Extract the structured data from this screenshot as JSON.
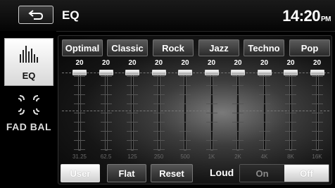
{
  "header": {
    "title": "EQ",
    "time": "14:20",
    "ampm": "PM"
  },
  "sidebar": {
    "eq_label": "EQ",
    "fad_bal_label": "FAD BAL"
  },
  "presets": [
    "Optimal",
    "Classic",
    "Rock",
    "Jazz",
    "Techno",
    "Pop"
  ],
  "bands": [
    {
      "freq": "31.25",
      "value": "20"
    },
    {
      "freq": "62.5",
      "value": "20"
    },
    {
      "freq": "125",
      "value": "20"
    },
    {
      "freq": "250",
      "value": "20"
    },
    {
      "freq": "500",
      "value": "20"
    },
    {
      "freq": "1K",
      "value": "20"
    },
    {
      "freq": "2K",
      "value": "20"
    },
    {
      "freq": "4K",
      "value": "20"
    },
    {
      "freq": "8K",
      "value": "20"
    },
    {
      "freq": "16K",
      "value": "20"
    }
  ],
  "bottom": {
    "user_label": "User",
    "flat_label": "Flat",
    "reset_label": "Reset",
    "loud_label": "Loud",
    "on_label": "On",
    "off_label": "Off",
    "loud_state": "Off"
  },
  "colors": {
    "accent": "#ffffff",
    "background": "#000000"
  }
}
